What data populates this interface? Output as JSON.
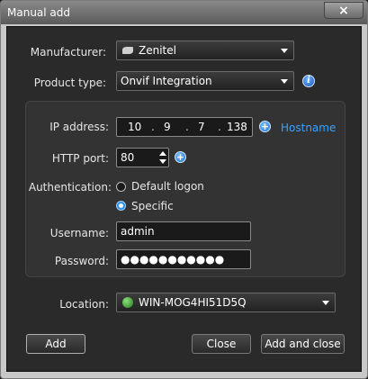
{
  "window": {
    "title": "Manual add",
    "close_glyph": "×"
  },
  "fields": {
    "manufacturer": {
      "label": "Manufacturer:",
      "value": "Zenitel",
      "icon": "manufacturer-logo-icon"
    },
    "product_type": {
      "label": "Product type:",
      "value": "Onvif Integration"
    },
    "ip_address": {
      "label": "IP address:",
      "segments": [
        "10",
        "9",
        "7",
        "138"
      ]
    },
    "hostname_link": "Hostname",
    "http_port": {
      "label": "HTTP port:",
      "value": "80"
    },
    "authentication": {
      "label": "Authentication:",
      "options": [
        {
          "label": "Default logon",
          "checked": false
        },
        {
          "label": "Specific",
          "checked": true
        }
      ]
    },
    "username": {
      "label": "Username:",
      "value": "admin"
    },
    "password": {
      "label": "Password:",
      "value": "●●●●●●●●●●●"
    },
    "location": {
      "label": "Location:",
      "value": "WIN-MOG4HI51D5Q",
      "icon": "globe-icon"
    }
  },
  "buttons": {
    "add": "Add",
    "close": "Close",
    "add_and_close": "Add and close"
  },
  "icons": {
    "info": "i",
    "plus": "+"
  },
  "colors": {
    "accent": "#3aa0ff",
    "background": "#2a2a2a",
    "titlebar": "#6a6a6a"
  }
}
